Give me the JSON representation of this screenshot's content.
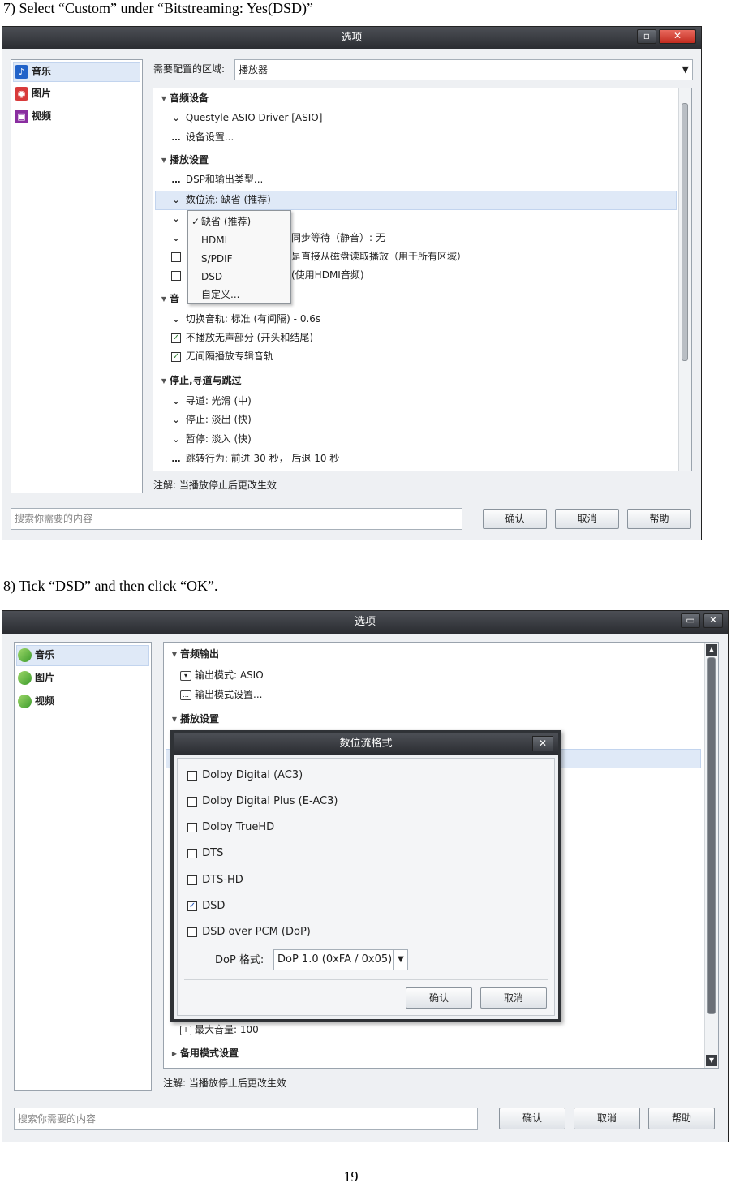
{
  "captions": {
    "step7": "7) Select “Custom” under “Bitstreaming: Yes(DSD)”",
    "step8": "8) Tick “DSD” and then click “OK”."
  },
  "page_number": "19",
  "screen1": {
    "window_title": "选项",
    "nav": [
      {
        "label": "音乐",
        "icon": "music-note-icon"
      },
      {
        "label": "图片",
        "icon": "camera-icon"
      },
      {
        "label": "视频",
        "icon": "film-icon"
      }
    ],
    "zone_label": "需要配置的区域:",
    "zone_value": "播放器",
    "groups": {
      "audio_device": "音频设备",
      "playback": "播放设置",
      "stop_seek": "停止,寻道与跳过",
      "track_partial": "音"
    },
    "items": {
      "driver": "Questyle ASIO Driver [ASIO]",
      "device_settings": "设备设置...",
      "dsp": "DSP和输出类型...",
      "bitstream": "数位流: 缺省 (推荐)",
      "row3_tail": ")",
      "row4_tail": "同步等待（静音）: 无",
      "row5_tail": "是直接从磁盘读取播放（用于所有区域）",
      "row6_tail": "(使用HDMI音频)",
      "switch_track": "切换音轨: 标准 (有间隔) - 0.6s",
      "skip_silence": "不播放无声部分 (开头和结尾)",
      "gapless": "无间隔播放专辑音轨",
      "seek": "寻道: 光滑 (中)",
      "stop": "停止: 淡出 (快)",
      "pause": "暂停: 淡入 (快)",
      "skip": "跳转行为: 前进 30 秒， 后退 10 秒"
    },
    "dropdown": [
      {
        "label": "缺省 (推荐)",
        "checked": true
      },
      {
        "label": "HDMI",
        "checked": false
      },
      {
        "label": "S/PDIF",
        "checked": false
      },
      {
        "label": "DSD",
        "checked": false
      },
      {
        "label": "自定义...",
        "checked": false
      }
    ],
    "note": "注解: 当播放停止后更改生效",
    "search_placeholder": "搜索你需要的内容",
    "buttons": {
      "ok": "确认",
      "cancel": "取消",
      "help": "帮助"
    }
  },
  "screen2": {
    "window_title": "选项",
    "nav": [
      {
        "label": "音乐"
      },
      {
        "label": "图片"
      },
      {
        "label": "视频"
      }
    ],
    "groups": {
      "audio_output": "音频输出",
      "playback": "播放设置",
      "backup": "备用模式设置"
    },
    "items": {
      "output_mode": "输出模式: ASIO",
      "output_mode_settings": "输出模式设置...",
      "max_volume": "最大音量: 100"
    },
    "dialog": {
      "title": "数位流格式",
      "options": [
        {
          "label": "Dolby Digital (AC3)",
          "checked": false
        },
        {
          "label": "Dolby Digital Plus (E-AC3)",
          "checked": false
        },
        {
          "label": "Dolby TrueHD",
          "checked": false
        },
        {
          "label": "DTS",
          "checked": false
        },
        {
          "label": "DTS-HD",
          "checked": false
        },
        {
          "label": "DSD",
          "checked": true
        },
        {
          "label": "DSD over PCM (DoP)",
          "checked": false
        }
      ],
      "dop_label": "DoP 格式:",
      "dop_value": "DoP 1.0 (0xFA / 0x05)",
      "ok": "确认",
      "cancel": "取消"
    },
    "note": "注解: 当播放停止后更改生效",
    "search_placeholder": "搜索你需要的内容",
    "buttons": {
      "ok": "确认",
      "cancel": "取消",
      "help": "帮助"
    }
  }
}
